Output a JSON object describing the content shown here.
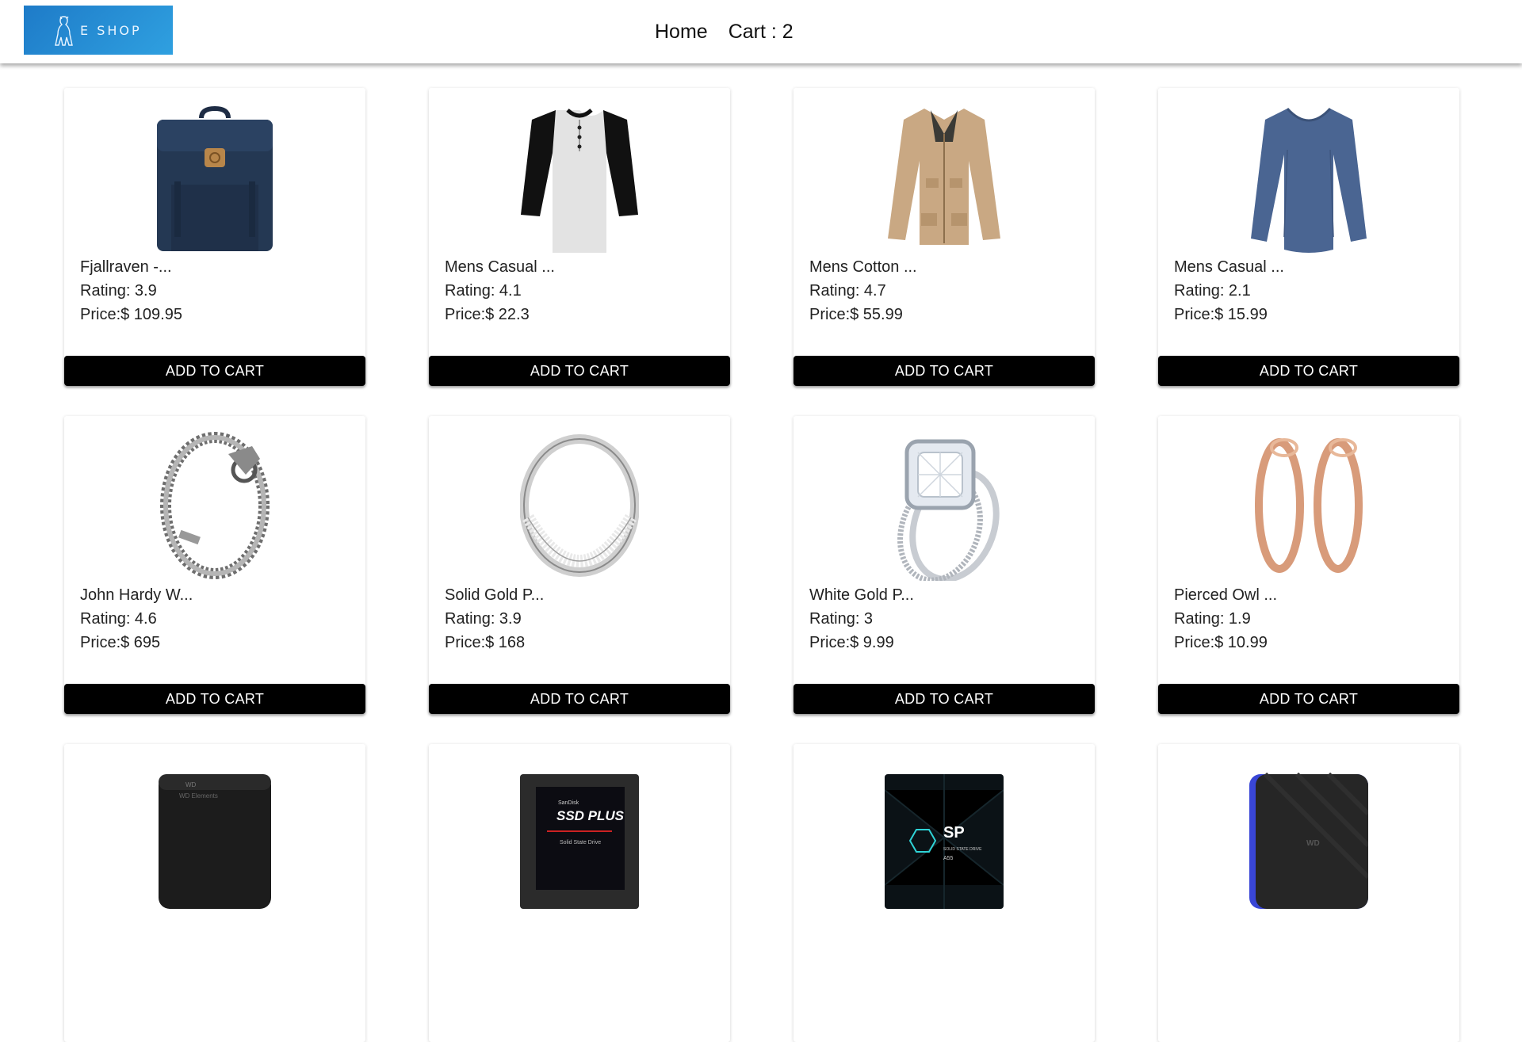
{
  "header": {
    "logo_text": "E SHOP",
    "nav": {
      "home": "Home",
      "cart": "Cart : 2"
    }
  },
  "colors": {
    "logo_bg": "#1e7bc8",
    "button_bg": "#000000"
  },
  "products": [
    {
      "title": "Fjallraven -...",
      "rating": "Rating: 3.9",
      "price": "Price:$ 109.95",
      "icon": "backpack",
      "button": "ADD TO CART"
    },
    {
      "title": "Mens Casual ...",
      "rating": "Rating: 4.1",
      "price": "Price:$ 22.3",
      "icon": "raglan-shirt",
      "button": "ADD TO CART"
    },
    {
      "title": "Mens Cotton ...",
      "rating": "Rating: 4.7",
      "price": "Price:$ 55.99",
      "icon": "jacket",
      "button": "ADD TO CART"
    },
    {
      "title": "Mens Casual ...",
      "rating": "Rating: 2.1",
      "price": "Price:$ 15.99",
      "icon": "long-sleeve-shirt",
      "button": "ADD TO CART"
    },
    {
      "title": "John Hardy W...",
      "rating": "Rating: 4.6",
      "price": "Price:$ 695",
      "icon": "bracelet",
      "button": "ADD TO CART"
    },
    {
      "title": "Solid Gold P...",
      "rating": "Rating: 3.9",
      "price": "Price:$ 168",
      "icon": "silver-ring",
      "button": "ADD TO CART"
    },
    {
      "title": "White Gold P...",
      "rating": "Rating: 3",
      "price": "Price:$ 9.99",
      "icon": "diamond-ring",
      "button": "ADD TO CART"
    },
    {
      "title": "Pierced Owl ...",
      "rating": "Rating: 1.9",
      "price": "Price:$ 10.99",
      "icon": "rose-gold-tunnels",
      "button": "ADD TO CART"
    },
    {
      "title": "",
      "rating": "",
      "price": "",
      "icon": "external-hard-drive",
      "button": ""
    },
    {
      "title": "",
      "rating": "",
      "price": "",
      "icon": "ssd-plus",
      "button": ""
    },
    {
      "title": "",
      "rating": "",
      "price": "",
      "icon": "sp-ssd",
      "button": ""
    },
    {
      "title": "",
      "rating": "",
      "price": "",
      "icon": "portable-drive",
      "button": ""
    }
  ],
  "ssd_label": {
    "brand": "SanDisk",
    "model": "SSD PLUS",
    "sub": "Solid State Drive"
  },
  "sp_label": {
    "brand": "SP",
    "sub": "SOLID STATE DRIVE",
    "model": "A55"
  },
  "wd_label": {
    "brand": "WD",
    "sub": "WD Elements"
  }
}
